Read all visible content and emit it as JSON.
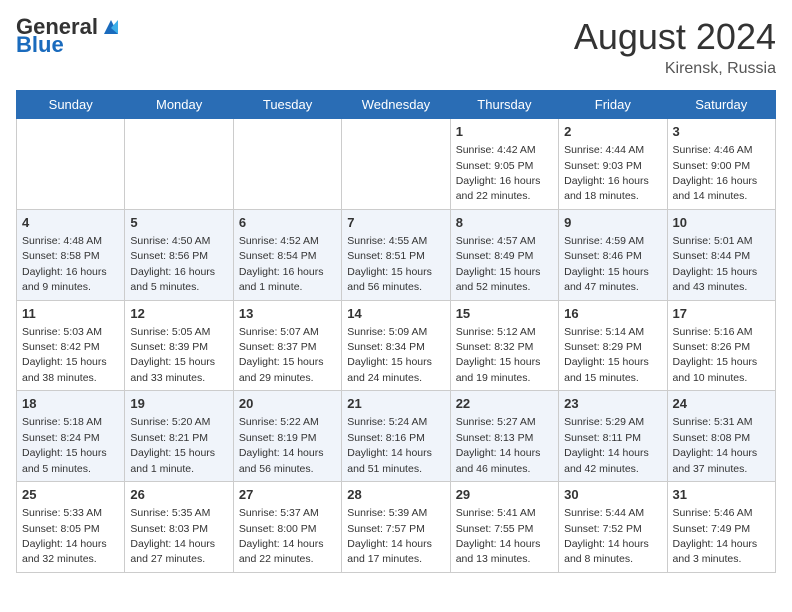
{
  "header": {
    "logo_general": "General",
    "logo_blue": "Blue",
    "month_year": "August 2024",
    "location": "Kirensk, Russia"
  },
  "days_of_week": [
    "Sunday",
    "Monday",
    "Tuesday",
    "Wednesday",
    "Thursday",
    "Friday",
    "Saturday"
  ],
  "weeks": [
    [
      {
        "day": "",
        "info": ""
      },
      {
        "day": "",
        "info": ""
      },
      {
        "day": "",
        "info": ""
      },
      {
        "day": "",
        "info": ""
      },
      {
        "day": "1",
        "info": "Sunrise: 4:42 AM\nSunset: 9:05 PM\nDaylight: 16 hours\nand 22 minutes."
      },
      {
        "day": "2",
        "info": "Sunrise: 4:44 AM\nSunset: 9:03 PM\nDaylight: 16 hours\nand 18 minutes."
      },
      {
        "day": "3",
        "info": "Sunrise: 4:46 AM\nSunset: 9:00 PM\nDaylight: 16 hours\nand 14 minutes."
      }
    ],
    [
      {
        "day": "4",
        "info": "Sunrise: 4:48 AM\nSunset: 8:58 PM\nDaylight: 16 hours\nand 9 minutes."
      },
      {
        "day": "5",
        "info": "Sunrise: 4:50 AM\nSunset: 8:56 PM\nDaylight: 16 hours\nand 5 minutes."
      },
      {
        "day": "6",
        "info": "Sunrise: 4:52 AM\nSunset: 8:54 PM\nDaylight: 16 hours\nand 1 minute."
      },
      {
        "day": "7",
        "info": "Sunrise: 4:55 AM\nSunset: 8:51 PM\nDaylight: 15 hours\nand 56 minutes."
      },
      {
        "day": "8",
        "info": "Sunrise: 4:57 AM\nSunset: 8:49 PM\nDaylight: 15 hours\nand 52 minutes."
      },
      {
        "day": "9",
        "info": "Sunrise: 4:59 AM\nSunset: 8:46 PM\nDaylight: 15 hours\nand 47 minutes."
      },
      {
        "day": "10",
        "info": "Sunrise: 5:01 AM\nSunset: 8:44 PM\nDaylight: 15 hours\nand 43 minutes."
      }
    ],
    [
      {
        "day": "11",
        "info": "Sunrise: 5:03 AM\nSunset: 8:42 PM\nDaylight: 15 hours\nand 38 minutes."
      },
      {
        "day": "12",
        "info": "Sunrise: 5:05 AM\nSunset: 8:39 PM\nDaylight: 15 hours\nand 33 minutes."
      },
      {
        "day": "13",
        "info": "Sunrise: 5:07 AM\nSunset: 8:37 PM\nDaylight: 15 hours\nand 29 minutes."
      },
      {
        "day": "14",
        "info": "Sunrise: 5:09 AM\nSunset: 8:34 PM\nDaylight: 15 hours\nand 24 minutes."
      },
      {
        "day": "15",
        "info": "Sunrise: 5:12 AM\nSunset: 8:32 PM\nDaylight: 15 hours\nand 19 minutes."
      },
      {
        "day": "16",
        "info": "Sunrise: 5:14 AM\nSunset: 8:29 PM\nDaylight: 15 hours\nand 15 minutes."
      },
      {
        "day": "17",
        "info": "Sunrise: 5:16 AM\nSunset: 8:26 PM\nDaylight: 15 hours\nand 10 minutes."
      }
    ],
    [
      {
        "day": "18",
        "info": "Sunrise: 5:18 AM\nSunset: 8:24 PM\nDaylight: 15 hours\nand 5 minutes."
      },
      {
        "day": "19",
        "info": "Sunrise: 5:20 AM\nSunset: 8:21 PM\nDaylight: 15 hours\nand 1 minute."
      },
      {
        "day": "20",
        "info": "Sunrise: 5:22 AM\nSunset: 8:19 PM\nDaylight: 14 hours\nand 56 minutes."
      },
      {
        "day": "21",
        "info": "Sunrise: 5:24 AM\nSunset: 8:16 PM\nDaylight: 14 hours\nand 51 minutes."
      },
      {
        "day": "22",
        "info": "Sunrise: 5:27 AM\nSunset: 8:13 PM\nDaylight: 14 hours\nand 46 minutes."
      },
      {
        "day": "23",
        "info": "Sunrise: 5:29 AM\nSunset: 8:11 PM\nDaylight: 14 hours\nand 42 minutes."
      },
      {
        "day": "24",
        "info": "Sunrise: 5:31 AM\nSunset: 8:08 PM\nDaylight: 14 hours\nand 37 minutes."
      }
    ],
    [
      {
        "day": "25",
        "info": "Sunrise: 5:33 AM\nSunset: 8:05 PM\nDaylight: 14 hours\nand 32 minutes."
      },
      {
        "day": "26",
        "info": "Sunrise: 5:35 AM\nSunset: 8:03 PM\nDaylight: 14 hours\nand 27 minutes."
      },
      {
        "day": "27",
        "info": "Sunrise: 5:37 AM\nSunset: 8:00 PM\nDaylight: 14 hours\nand 22 minutes."
      },
      {
        "day": "28",
        "info": "Sunrise: 5:39 AM\nSunset: 7:57 PM\nDaylight: 14 hours\nand 17 minutes."
      },
      {
        "day": "29",
        "info": "Sunrise: 5:41 AM\nSunset: 7:55 PM\nDaylight: 14 hours\nand 13 minutes."
      },
      {
        "day": "30",
        "info": "Sunrise: 5:44 AM\nSunset: 7:52 PM\nDaylight: 14 hours\nand 8 minutes."
      },
      {
        "day": "31",
        "info": "Sunrise: 5:46 AM\nSunset: 7:49 PM\nDaylight: 14 hours\nand 3 minutes."
      }
    ]
  ]
}
